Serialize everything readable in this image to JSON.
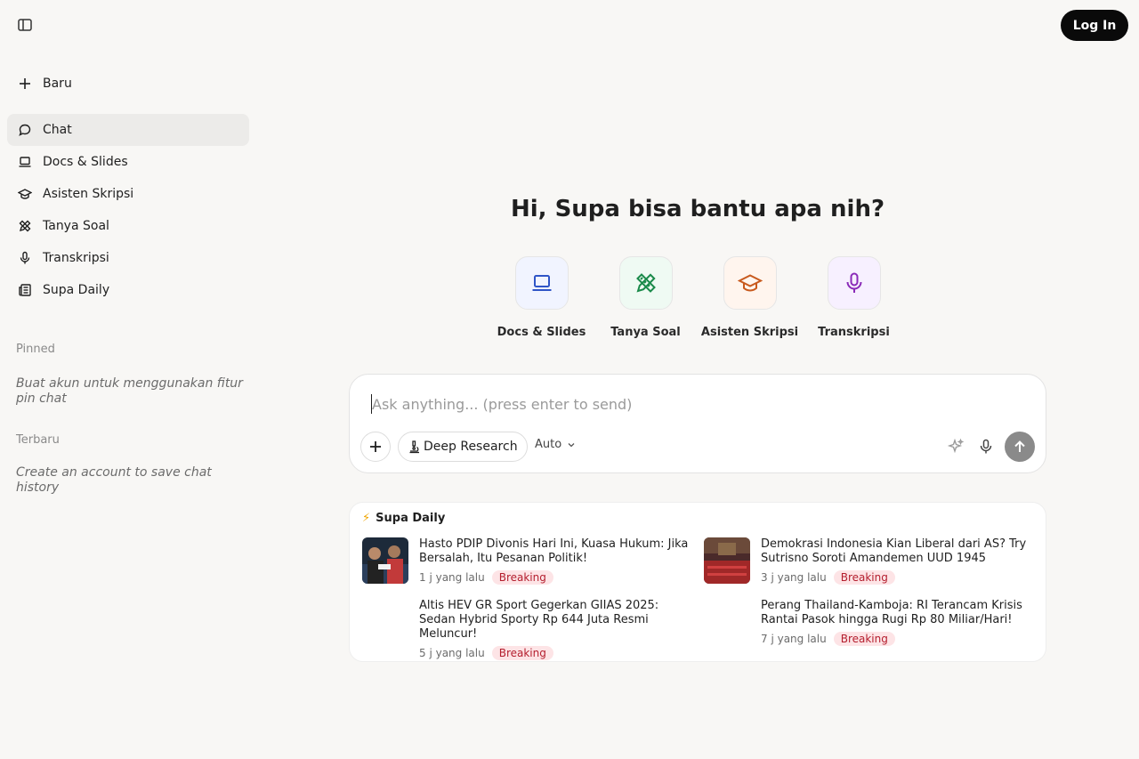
{
  "sidebar": {
    "new_label": "Baru",
    "items": [
      {
        "label": "Chat",
        "icon": "chat-bubble-icon",
        "active": true
      },
      {
        "label": "Docs & Slides",
        "icon": "laptop-icon"
      },
      {
        "label": "Asisten Skripsi",
        "icon": "graduation-cap-icon"
      },
      {
        "label": "Tanya Soal",
        "icon": "pencil-ruler-icon"
      },
      {
        "label": "Transkripsi",
        "icon": "microphone-icon"
      },
      {
        "label": "Supa Daily",
        "icon": "newspaper-icon"
      }
    ],
    "pinned_title": "Pinned",
    "pinned_note": "Buat akun untuk menggunakan fitur pin chat",
    "recent_title": "Terbaru",
    "recent_note": "Create an account to save chat history"
  },
  "header": {
    "login_label": "Log In"
  },
  "main": {
    "greeting": "Hi, Supa bisa bantu apa nih?",
    "shortcuts": [
      {
        "label": "Docs & Slides",
        "icon": "laptop-icon",
        "color": "#2f55c7",
        "bg": "#f1f4ff"
      },
      {
        "label": "Tanya Soal",
        "icon": "pencil-ruler-icon",
        "color": "#1a8a4a",
        "bg": "#effaf3"
      },
      {
        "label": "Asisten Skripsi",
        "icon": "graduation-cap-icon",
        "color": "#c85a1e",
        "bg": "#fff5ee"
      },
      {
        "label": "Transkripsi",
        "icon": "microphone-icon",
        "color": "#8a2ab8",
        "bg": "#f7f0ff"
      }
    ],
    "composer": {
      "placeholder": "Ask anything... (press enter to send)",
      "deep_research_label": "Deep Research",
      "model_label": "Auto"
    },
    "daily": {
      "title": "Supa Daily",
      "news": [
        {
          "title": "Hasto PDIP Divonis Hari Ini, Kuasa Hukum: Jika Bersalah, Itu Pesanan Politik!",
          "time": "1 j yang lalu",
          "badge": "Breaking"
        },
        {
          "title": "Demokrasi Indonesia Kian Liberal dari AS? Try Sutrisno Soroti Amandemen UUD 1945",
          "time": "3 j yang lalu",
          "badge": "Breaking"
        },
        {
          "title": "Altis HEV GR Sport Gegerkan GIIAS 2025: Sedan Hybrid Sporty Rp 644 Juta Resmi Meluncur!",
          "time": "5 j yang lalu",
          "badge": "Breaking"
        },
        {
          "title": "Perang Thailand-Kamboja: RI Terancam Krisis Rantai Pasok hingga Rugi Rp 80 Miliar/Hari!",
          "time": "7 j yang lalu",
          "badge": "Breaking"
        }
      ]
    }
  }
}
